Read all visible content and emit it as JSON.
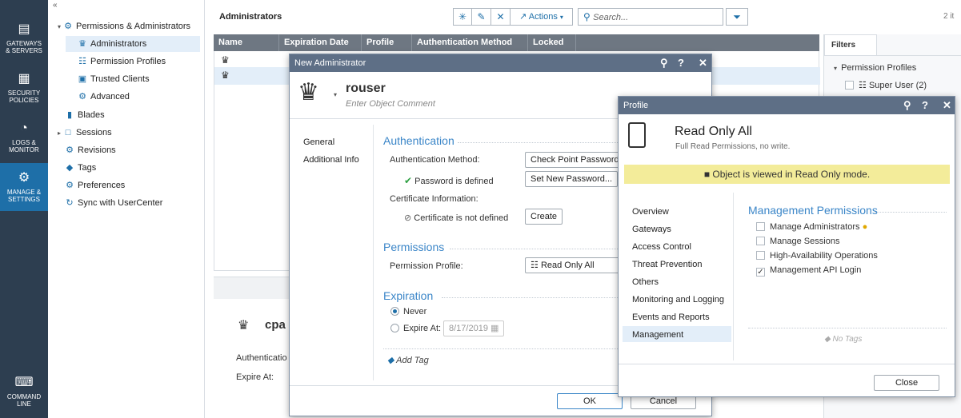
{
  "rail": {
    "items": [
      {
        "label_1": "GATEWAYS",
        "label_2": "& SERVERS",
        "icon": "gateways-icon"
      },
      {
        "label_1": "SECURITY",
        "label_2": "POLICIES",
        "icon": "policies-icon"
      },
      {
        "label_1": "LOGS &",
        "label_2": "MONITOR",
        "icon": "logs-icon"
      },
      {
        "label_1": "MANAGE &",
        "label_2": "SETTINGS",
        "icon": "gear-icon"
      },
      {
        "label_1": "COMMAND",
        "label_2": "LINE",
        "icon": "command-line-icon"
      }
    ],
    "collapse_glyph": "«"
  },
  "tree": {
    "root": "Permissions & Administrators",
    "children": [
      "Administrators",
      "Permission Profiles",
      "Trusted Clients",
      "Advanced"
    ],
    "items": [
      "Blades",
      "Sessions",
      "Revisions",
      "Tags",
      "Preferences",
      "Sync with UserCenter"
    ]
  },
  "main": {
    "title": "Administrators",
    "actions_label": "Actions",
    "search_placeholder": "Search...",
    "item_count": "2 it",
    "columns": [
      "Name",
      "Expiration Date",
      "Profile",
      "Authentication Method",
      "Locked"
    ],
    "detail_name": "cpa",
    "detail_auth_label": "Authenticatio",
    "detail_expire_label": "Expire At:"
  },
  "filters": {
    "tab": "Filters",
    "group": "Permission Profiles",
    "item": "Super User (2)"
  },
  "new_admin": {
    "title": "New Administrator",
    "name": "rouser",
    "comment_placeholder": "Enter Object Comment",
    "nav": [
      "General",
      "Additional Info"
    ],
    "auth_section": "Authentication",
    "auth_method_label": "Authentication Method:",
    "auth_method_value": "Check Point Password",
    "password_status": "Password is defined",
    "set_password_btn": "Set New Password...",
    "cert_info_label": "Certificate Information:",
    "cert_status": "Certificate is not defined",
    "create_btn": "Create",
    "perm_section": "Permissions",
    "perm_profile_label": "Permission Profile:",
    "perm_profile_value": "Read Only All",
    "exp_section": "Expiration",
    "never_label": "Never",
    "expire_at_label": "Expire At:",
    "expire_date": "8/17/2019",
    "add_tag": "Add Tag",
    "ok_btn": "OK",
    "cancel_btn": "Cancel"
  },
  "profile": {
    "title": "Profile",
    "name": "Read Only All",
    "comment": "Full Read Permissions, no write.",
    "readonly_banner": "Object is viewed in Read Only mode.",
    "nav": [
      "Overview",
      "Gateways",
      "Access Control",
      "Threat Prevention",
      "Others",
      "Monitoring and Logging",
      "Events and Reports",
      "Management"
    ],
    "section": "Management Permissions",
    "perms": [
      {
        "label": "Manage Administrators",
        "checked": false
      },
      {
        "label": "Manage Sessions",
        "checked": false
      },
      {
        "label": "High-Availability Operations",
        "checked": false
      },
      {
        "label": "Management API Login",
        "checked": true
      }
    ],
    "no_tags": "No Tags",
    "close_btn": "Close"
  }
}
